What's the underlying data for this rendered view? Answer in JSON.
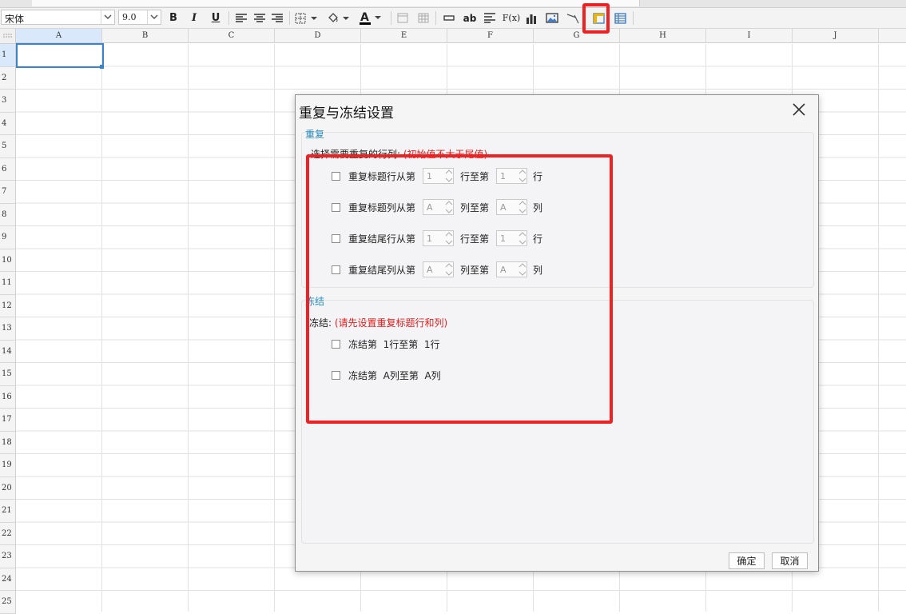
{
  "toolbar": {
    "font_name": "宋体",
    "font_size": "9.0",
    "bold_label": "B",
    "italic_label": "I",
    "underline_label": "U",
    "text_label": "ab",
    "formula_label": "F(x)",
    "font_color_label": "A",
    "font_color": "#000000",
    "highlight_color": "#ee2222"
  },
  "grid": {
    "columns": [
      "A",
      "B",
      "C",
      "D",
      "E",
      "F",
      "G",
      "H",
      "I",
      "J"
    ],
    "rows": [
      "1",
      "2",
      "3",
      "4",
      "5",
      "6",
      "7",
      "8",
      "9",
      "10",
      "11",
      "12",
      "13",
      "14",
      "15",
      "16",
      "17",
      "18",
      "19",
      "20",
      "21",
      "22",
      "23",
      "24",
      "25"
    ],
    "selected_cell": "A1"
  },
  "dialog": {
    "title": "重复与冻结设置",
    "repeat": {
      "title": "重复",
      "select_label": "选择需要重复的行列:",
      "select_note": "(初始值不大于尾值)",
      "options": [
        {
          "from_label": "重复标题行从第",
          "from_value": "1",
          "to_label": "行至第",
          "to_value": "1",
          "unit": "行",
          "checked": false
        },
        {
          "from_label": "重复标题列从第",
          "from_value": "A",
          "to_label": "列至第",
          "to_value": "A",
          "unit": "列",
          "checked": false
        },
        {
          "from_label": "重复结尾行从第",
          "from_value": "1",
          "to_label": "行至第",
          "to_value": "1",
          "unit": "行",
          "checked": false
        },
        {
          "from_label": "重复结尾列从第",
          "from_value": "A",
          "to_label": "列至第",
          "to_value": "A",
          "unit": "列",
          "checked": false
        }
      ]
    },
    "freeze": {
      "title": "冻结",
      "label": "冻结:",
      "note": "(请先设置重复标题行和列)",
      "options": [
        {
          "text": "冻结第  1行至第  1行",
          "checked": false
        },
        {
          "text": "冻结第  A列至第  A列",
          "checked": false
        }
      ]
    },
    "ok_label": "确定",
    "cancel_label": "取消"
  }
}
